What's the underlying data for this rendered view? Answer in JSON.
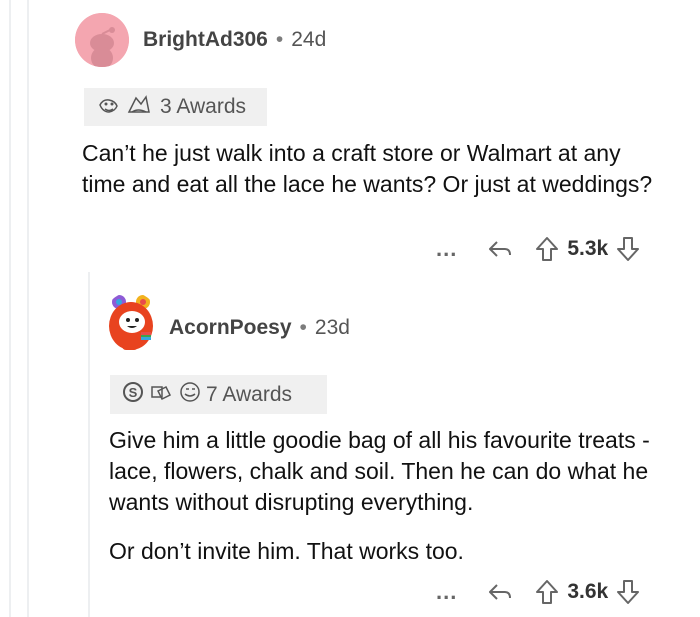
{
  "comments": [
    {
      "username": "BrightAd306",
      "separator": "•",
      "age": "24d",
      "awards_label": "3 Awards",
      "body": [
        "Can’t he just walk into a craft store or Walmart at any time and eat all the lace he wants? Or just at weddings?"
      ],
      "more_label": "...",
      "votes": "5.3k",
      "avatar_color": "#f4a6b0"
    },
    {
      "username": "AcornPoesy",
      "separator": "•",
      "age": "23d",
      "awards_label": "7 Awards",
      "body": [
        "Give him a little goodie bag of all his favourite treats - lace, flowers, chalk and soil. Then he can do what he wants without disrupting everything.",
        "Or don’t invite him. That works too."
      ],
      "more_label": "...",
      "votes": "3.6k",
      "avatar_color": "#e8431f"
    }
  ],
  "icons": {
    "reply": "reply-arrow-icon",
    "upvote": "upvote-arrow-icon",
    "downvote": "downvote-arrow-icon"
  }
}
